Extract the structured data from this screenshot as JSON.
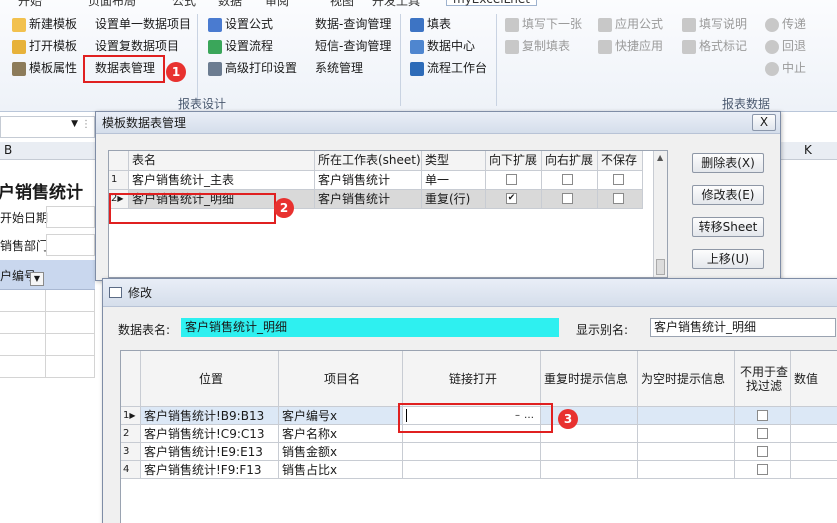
{
  "ribbon": {
    "tabs": [
      "开始",
      "页面布局",
      "公式",
      "数据",
      "审阅",
      "视图",
      "开发工具",
      "myExcelLnet"
    ],
    "col1": [
      "新建模板",
      "打开模板",
      "模板属性"
    ],
    "col2": [
      "设置单一数据项目",
      "设置复数据项目",
      "数据表管理"
    ],
    "col3": [
      "设置公式",
      "设置流程",
      "高级打印设置"
    ],
    "col4": [
      "数据-查询管理",
      "短信-查询管理",
      "系统管理"
    ],
    "col5": [
      "填表",
      "数据中心",
      "流程工作台"
    ],
    "col6": [
      "填写下一张",
      "复制填表"
    ],
    "col7": [
      "应用公式",
      "快捷应用"
    ],
    "col8": [
      "填写说明",
      "格式标记"
    ],
    "col9": [
      "传递",
      "回退",
      "中止"
    ],
    "group_design": "报表设计",
    "group_data": "报表数据",
    "badges": [
      "1",
      "2",
      "3"
    ]
  },
  "sheet": {
    "col_b": "B",
    "col_k": "K",
    "title": "户销售统计",
    "start_date": "开始日期",
    "sales_dept": "销售部门",
    "customer_id": "户编号"
  },
  "dialog1": {
    "title": "模板数据表管理",
    "headers": [
      "表名",
      "所在工作表(sheet)",
      "类型",
      "向下扩展",
      "向右扩展",
      "不保存"
    ],
    "rows": [
      {
        "num": "1",
        "name": "客户销售统计_主表",
        "sheet": "客户销售统计",
        "type": "单一",
        "down": false,
        "right": false,
        "nosave": false
      },
      {
        "num": "2",
        "name": "客户销售统计_明细",
        "sheet": "客户销售统计",
        "type": "重复(行)",
        "down": true,
        "right": false,
        "nosave": false
      }
    ],
    "buttons": [
      "删除表(X)",
      "修改表(E)",
      "转移Sheet",
      "上移(U)"
    ],
    "close": "X"
  },
  "dialog2": {
    "title": "修改",
    "table_name_label": "数据表名:",
    "table_name_value": "客户销售统计_明细",
    "alias_label": "显示别名:",
    "alias_value": "客户销售统计_明细",
    "headers": [
      "位置",
      "项目名",
      "链接打开",
      "重复时提示信息",
      "为空时提示信息",
      "不用于查找过滤",
      "数值"
    ],
    "rows": [
      {
        "num": "1",
        "pos": "客户销售统计!B9:B13",
        "item": "客户编号x"
      },
      {
        "num": "2",
        "pos": "客户销售统计!C9:C13",
        "item": "客户名称x"
      },
      {
        "num": "3",
        "pos": "客户销售统计!E9:E13",
        "item": "销售金额x"
      },
      {
        "num": "4",
        "pos": "客户销售统计!F9:F13",
        "item": "销售占比x"
      }
    ],
    "link_editor_button": "…"
  }
}
